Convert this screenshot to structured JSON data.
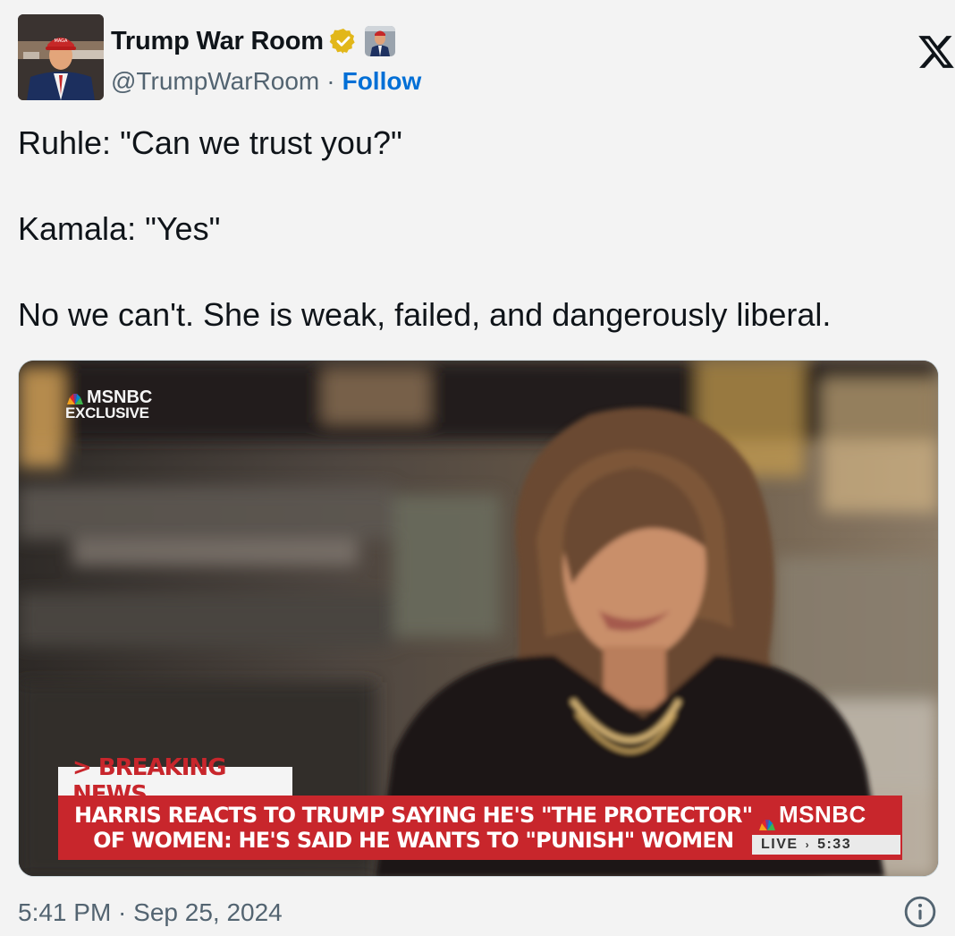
{
  "author": {
    "display_name": "Trump War Room",
    "handle": "@TrumpWarRoom",
    "separator": "·",
    "follow_label": "Follow",
    "verified_badge_color": "#e2b719",
    "avatar_icon": "profile-photo",
    "flag_icon": "profile-flag-emoji"
  },
  "platform": {
    "logo_icon": "x-logo-icon"
  },
  "tweet": {
    "lines": [
      "Ruhle: \"Can we trust you?\"",
      "Kamala: \"Yes\"",
      "No we can't. She is weak, failed, and dangerously liberal."
    ]
  },
  "media": {
    "type": "video-frame",
    "network_logo_line1": "MSNBC",
    "network_logo_line2": "EXCLUSIVE",
    "breaking_tag": "> BREAKING NEWS",
    "headline_line1": "HARRIS REACTS TO TRUMP SAYING HE'S \"THE PROTECTOR\"",
    "headline_line2": "OF WOMEN: HE'S SAID HE WANTS TO \"PUNISH\" WOMEN",
    "chyron_logo": "MSNBC",
    "live_label": "LIVE",
    "live_time": "5:33",
    "chyron_color": "#c8262c"
  },
  "footer": {
    "timestamp": "5:41 PM · Sep 25, 2024",
    "info_icon": "info-icon"
  },
  "colors": {
    "background": "#f3f3f3",
    "text": "#0f1419",
    "secondary_text": "#536471",
    "follow_link": "#006fd6"
  }
}
